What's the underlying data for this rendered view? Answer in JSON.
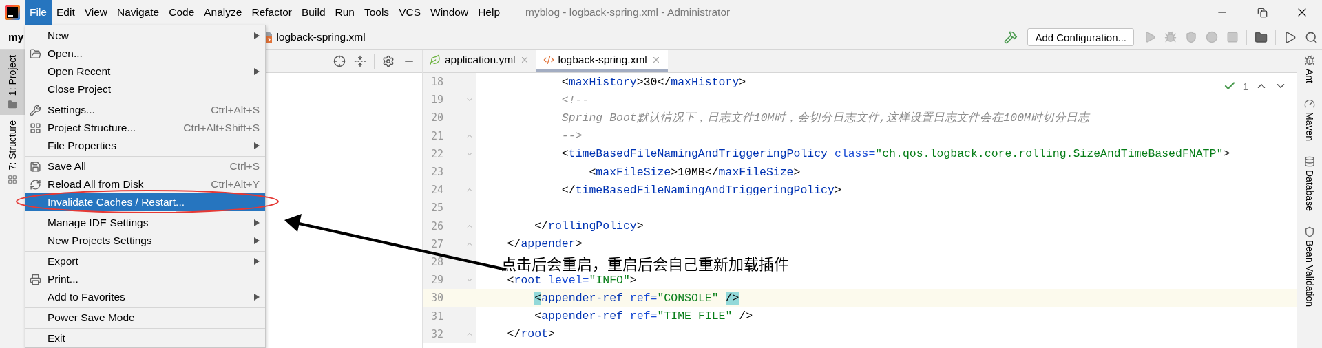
{
  "window": {
    "title": "myblog - logback-spring.xml - Administrator"
  },
  "menu_bar": [
    {
      "label": "File",
      "selected": true
    },
    {
      "label": "Edit",
      "selected": false
    },
    {
      "label": "View",
      "selected": false
    },
    {
      "label": "Navigate",
      "selected": false
    },
    {
      "label": "Code",
      "selected": false
    },
    {
      "label": "Analyze",
      "selected": false
    },
    {
      "label": "Refactor",
      "selected": false
    },
    {
      "label": "Build",
      "selected": false
    },
    {
      "label": "Run",
      "selected": false
    },
    {
      "label": "Tools",
      "selected": false
    },
    {
      "label": "VCS",
      "selected": false
    },
    {
      "label": "Window",
      "selected": false
    },
    {
      "label": "Help",
      "selected": false
    }
  ],
  "navigation": {
    "project": "my",
    "file": "logback-spring.xml"
  },
  "toolbar": {
    "configuration": "Add Configuration...",
    "run_actions": [
      {
        "disabled": true
      },
      {
        "disabled": true
      },
      {
        "disabled": true
      },
      {
        "disabled": true
      },
      {
        "disabled": true
      }
    ]
  },
  "left_strip": [
    {
      "label": "1: Project",
      "selected": true
    },
    {
      "label": "7: Structure",
      "selected": false
    }
  ],
  "right_strip": [
    {
      "label": "Ant"
    },
    {
      "label": "Maven"
    },
    {
      "label": "Database"
    },
    {
      "label": "Bean Validation"
    }
  ],
  "file_menu": {
    "groups": [
      [
        {
          "label": "New",
          "submenu": true,
          "selected": false
        },
        {
          "label": "Open...",
          "submenu": false,
          "selected": false
        },
        {
          "label": "Open Recent",
          "submenu": true,
          "selected": false
        },
        {
          "label": "Close Project",
          "submenu": false,
          "selected": false
        }
      ],
      [
        {
          "label": "Settings...",
          "shortcut": "Ctrl+Alt+S",
          "submenu": false,
          "selected": false
        },
        {
          "label": "Project Structure...",
          "shortcut": "Ctrl+Alt+Shift+S",
          "submenu": false,
          "selected": false
        },
        {
          "label": "File Properties",
          "submenu": true,
          "selected": false
        }
      ],
      [
        {
          "label": "Save All",
          "shortcut": "Ctrl+S",
          "submenu": false,
          "selected": false
        },
        {
          "label": "Reload All from Disk",
          "shortcut": "Ctrl+Alt+Y",
          "submenu": false,
          "selected": false
        },
        {
          "label": "Invalidate Caches / Restart...",
          "submenu": false,
          "selected": true
        }
      ],
      [
        {
          "label": "Manage IDE Settings",
          "submenu": true,
          "selected": false
        },
        {
          "label": "New Projects Settings",
          "submenu": true,
          "selected": false
        }
      ],
      [
        {
          "label": "Export",
          "submenu": true,
          "selected": false
        },
        {
          "label": "Print...",
          "submenu": false,
          "selected": false
        },
        {
          "label": "Add to Favorites",
          "submenu": true,
          "selected": false
        }
      ],
      [
        {
          "label": "Power Save Mode",
          "submenu": false,
          "selected": false
        }
      ],
      [
        {
          "label": "Exit",
          "submenu": false,
          "selected": false
        }
      ]
    ]
  },
  "editor_tabs": [
    {
      "label": "application.yml",
      "kind": "yml",
      "selected": false
    },
    {
      "label": "logback-spring.xml",
      "kind": "xml",
      "selected": true
    }
  ],
  "inspections": {
    "count": "1"
  },
  "code_lines": [
    {
      "number": "18",
      "current": false,
      "fold_start": false,
      "fold_end": false,
      "segments": [
        {
          "kind": "punct",
          "text": "            <"
        },
        {
          "kind": "tag",
          "text": "maxHistory"
        },
        {
          "kind": "punct",
          "text": ">"
        },
        {
          "kind": "text",
          "text": "30"
        },
        {
          "kind": "punct",
          "text": "</"
        },
        {
          "kind": "tag",
          "text": "maxHistory"
        },
        {
          "kind": "punct",
          "text": ">"
        }
      ]
    },
    {
      "number": "19",
      "current": false,
      "fold_start": true,
      "fold_end": false,
      "segments": [
        {
          "kind": "comment",
          "text": "            <!--"
        }
      ]
    },
    {
      "number": "20",
      "current": false,
      "fold_start": false,
      "fold_end": false,
      "segments": [
        {
          "kind": "comment",
          "text": "            Spring Boot默认情况下，日志文件10M时，会切分日志文件,这样设置日志文件会在100M时切分日志"
        }
      ]
    },
    {
      "number": "21",
      "current": false,
      "fold_start": false,
      "fold_end": true,
      "segments": [
        {
          "kind": "comment",
          "text": "            -->"
        }
      ]
    },
    {
      "number": "22",
      "current": false,
      "fold_start": true,
      "fold_end": false,
      "segments": [
        {
          "kind": "punct",
          "text": "            <"
        },
        {
          "kind": "tag",
          "text": "timeBasedFileNamingAndTriggeringPolicy"
        },
        {
          "kind": "attr",
          "text": " class="
        },
        {
          "kind": "string",
          "text": "\"ch.qos.logback.core.rolling.SizeAndTimeBasedFNATP\""
        },
        {
          "kind": "punct",
          "text": ">"
        }
      ]
    },
    {
      "number": "23",
      "current": false,
      "fold_start": false,
      "fold_end": false,
      "segments": [
        {
          "kind": "punct",
          "text": "                <"
        },
        {
          "kind": "tag",
          "text": "maxFileSize"
        },
        {
          "kind": "punct",
          "text": ">"
        },
        {
          "kind": "text",
          "text": "10MB"
        },
        {
          "kind": "punct",
          "text": "</"
        },
        {
          "kind": "tag",
          "text": "maxFileSize"
        },
        {
          "kind": "punct",
          "text": ">"
        }
      ]
    },
    {
      "number": "24",
      "current": false,
      "fold_start": false,
      "fold_end": true,
      "segments": [
        {
          "kind": "punct",
          "text": "            </"
        },
        {
          "kind": "tag",
          "text": "timeBasedFileNamingAndTriggeringPolicy"
        },
        {
          "kind": "punct",
          "text": ">"
        }
      ]
    },
    {
      "number": "25",
      "current": false,
      "fold_start": false,
      "fold_end": false
    },
    {
      "number": "26",
      "current": false,
      "fold_start": false,
      "fold_end": true,
      "segments": [
        {
          "kind": "punct",
          "text": "        </"
        },
        {
          "kind": "tag",
          "text": "rollingPolicy"
        },
        {
          "kind": "punct",
          "text": ">"
        }
      ]
    },
    {
      "number": "27",
      "current": false,
      "fold_start": false,
      "fold_end": true,
      "segments": [
        {
          "kind": "punct",
          "text": "    </"
        },
        {
          "kind": "tag",
          "text": "appender"
        },
        {
          "kind": "punct",
          "text": ">"
        }
      ]
    },
    {
      "number": "28",
      "current": false,
      "fold_start": false,
      "fold_end": false
    },
    {
      "number": "29",
      "current": false,
      "fold_start": true,
      "fold_end": false,
      "segments": [
        {
          "kind": "punct",
          "text": "    <"
        },
        {
          "kind": "tag",
          "text": "root"
        },
        {
          "kind": "attr",
          "text": " level="
        },
        {
          "kind": "string",
          "text": "\"INFO\""
        },
        {
          "kind": "punct",
          "text": ">"
        }
      ]
    },
    {
      "number": "30",
      "current": true,
      "fold_start": false,
      "fold_end": false,
      "segments": [
        {
          "kind": "punct",
          "text": "        <",
          "matched": true
        },
        {
          "kind": "tag",
          "text": "appender-ref"
        },
        {
          "kind": "attr",
          "text": " ref="
        },
        {
          "kind": "string",
          "text": "\"CONSOLE\""
        },
        {
          "kind": "punct",
          "text": " />",
          "matched": true
        }
      ]
    },
    {
      "number": "31",
      "current": false,
      "fold_start": false,
      "fold_end": false,
      "segments": [
        {
          "kind": "punct",
          "text": "        <"
        },
        {
          "kind": "tag",
          "text": "appender-ref"
        },
        {
          "kind": "attr",
          "text": " ref="
        },
        {
          "kind": "string",
          "text": "\"TIME_FILE\""
        },
        {
          "kind": "punct",
          "text": " />"
        }
      ]
    },
    {
      "number": "32",
      "current": false,
      "fold_start": false,
      "fold_end": true,
      "segments": [
        {
          "kind": "punct",
          "text": "    </"
        },
        {
          "kind": "tag",
          "text": "root"
        },
        {
          "kind": "punct",
          "text": ">"
        }
      ]
    }
  ],
  "annotation": {
    "text": "点击后会重启，重启后会自己重新加载插件"
  }
}
